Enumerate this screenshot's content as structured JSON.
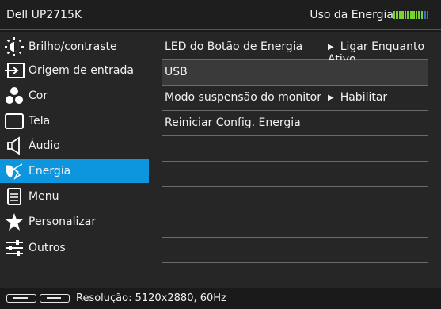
{
  "header": {
    "model": "Dell UP2715K",
    "energy_label": "Uso da Energia"
  },
  "sidebar": {
    "items": [
      {
        "label": "Brilho/contraste",
        "icon": "brightness-icon"
      },
      {
        "label": "Origem de entrada",
        "icon": "input-source-icon"
      },
      {
        "label": "Cor",
        "icon": "color-icon"
      },
      {
        "label": "Tela",
        "icon": "display-icon"
      },
      {
        "label": "Áudio",
        "icon": "audio-icon"
      },
      {
        "label": "Energia",
        "icon": "energy-icon",
        "active": true
      },
      {
        "label": "Menu",
        "icon": "menu-icon"
      },
      {
        "label": "Personalizar",
        "icon": "star-icon"
      },
      {
        "label": "Outros",
        "icon": "others-icon"
      }
    ]
  },
  "panel": {
    "rows": [
      {
        "label": "LED do Botão de Energia",
        "value": "Ligar Enquanto Ativo"
      },
      {
        "label": "USB",
        "value": ""
      },
      {
        "label": "Modo suspensão do monitor",
        "value": "Habilitar"
      },
      {
        "label": "Reiniciar Config. Energia",
        "value": ""
      }
    ]
  },
  "footer": {
    "resolution": "Resolução: 5120x2880, 60Hz"
  },
  "colors": {
    "accent": "#0d95de",
    "energy_green": "#7bd12f",
    "energy_blue": "#2f6fd1"
  }
}
